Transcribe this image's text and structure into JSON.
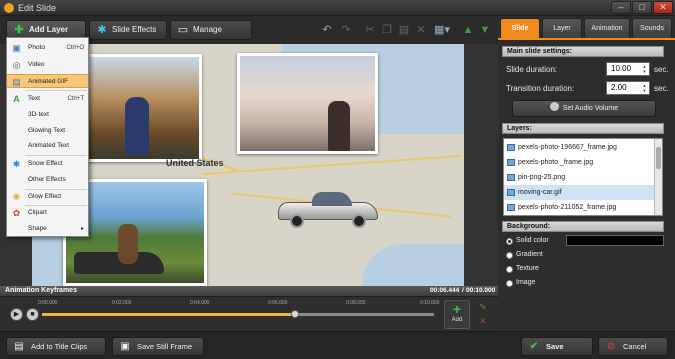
{
  "window": {
    "title": "Edit Slide",
    "minimize": "–",
    "maximize": "□",
    "close": "✕"
  },
  "toolbar": {
    "add_layer": "Add Layer",
    "slide_effects": "Slide Effects",
    "manage_camera": "Manage Camera"
  },
  "add_layer_menu": {
    "items": [
      {
        "label": "Photo",
        "shortcut": "Ctrl+O",
        "icon": "photo-icon"
      },
      {
        "label": "Video",
        "shortcut": "",
        "icon": "video-icon"
      },
      {
        "label": "Animated GIF",
        "shortcut": "",
        "icon": "gif-icon",
        "selected": true
      },
      {
        "label": "Text",
        "shortcut": "Ctrl+T",
        "icon": "text-icon"
      },
      {
        "label": "3D-text",
        "shortcut": "",
        "icon": ""
      },
      {
        "label": "Glowing Text",
        "shortcut": "",
        "icon": ""
      },
      {
        "label": "Animated Text",
        "shortcut": "",
        "icon": ""
      },
      {
        "label": "Snow Effect",
        "shortcut": "",
        "icon": "snowflake-icon"
      },
      {
        "label": "Other Effects",
        "shortcut": "",
        "icon": ""
      },
      {
        "label": "Glow Effect",
        "shortcut": "",
        "icon": "glow-icon"
      },
      {
        "label": "Clipart",
        "shortcut": "",
        "icon": "clipart-icon"
      },
      {
        "label": "Shape",
        "shortcut": "▸",
        "icon": ""
      }
    ]
  },
  "canvas": {
    "map_label": "United States"
  },
  "keyframes": {
    "title": "Animation Keyframes",
    "current_time": "00:06.444",
    "separator": "/",
    "total_time": "00:10.000",
    "ruler": [
      "0:00.000",
      "0:02.000",
      "0:04.000",
      "0:06.000",
      "0:08.000",
      "0:10.000"
    ],
    "position": 0.64,
    "add_label": "Add"
  },
  "tabs": [
    "Slide",
    "Layer",
    "Animation",
    "Sounds"
  ],
  "main_settings": {
    "header": "Main slide settings:",
    "slide_duration_label": "Slide duration:",
    "slide_duration": "10.00",
    "transition_duration_label": "Transition duration:",
    "transition_duration": "2.00",
    "unit": "sec.",
    "audio_button": "Set Audio Volume"
  },
  "layers": {
    "header": "Layers:",
    "items": [
      "pexels-photo-196667_frame.jpg",
      "pexels-photo _frame.jpg",
      "pin-png-25.png",
      "moving-car.gif",
      "pexels-photo-211052_frame.jpg"
    ],
    "selected_index": 3
  },
  "background": {
    "header": "Background:",
    "options": [
      "Solid color",
      "Gradient",
      "Texture",
      "Image"
    ],
    "selected": 0,
    "color": "#000000"
  },
  "bottom": {
    "add_to_title_clips": "Add to Title Clips",
    "save_still_frame": "Save Still Frame",
    "save": "Save",
    "cancel": "Cancel"
  }
}
